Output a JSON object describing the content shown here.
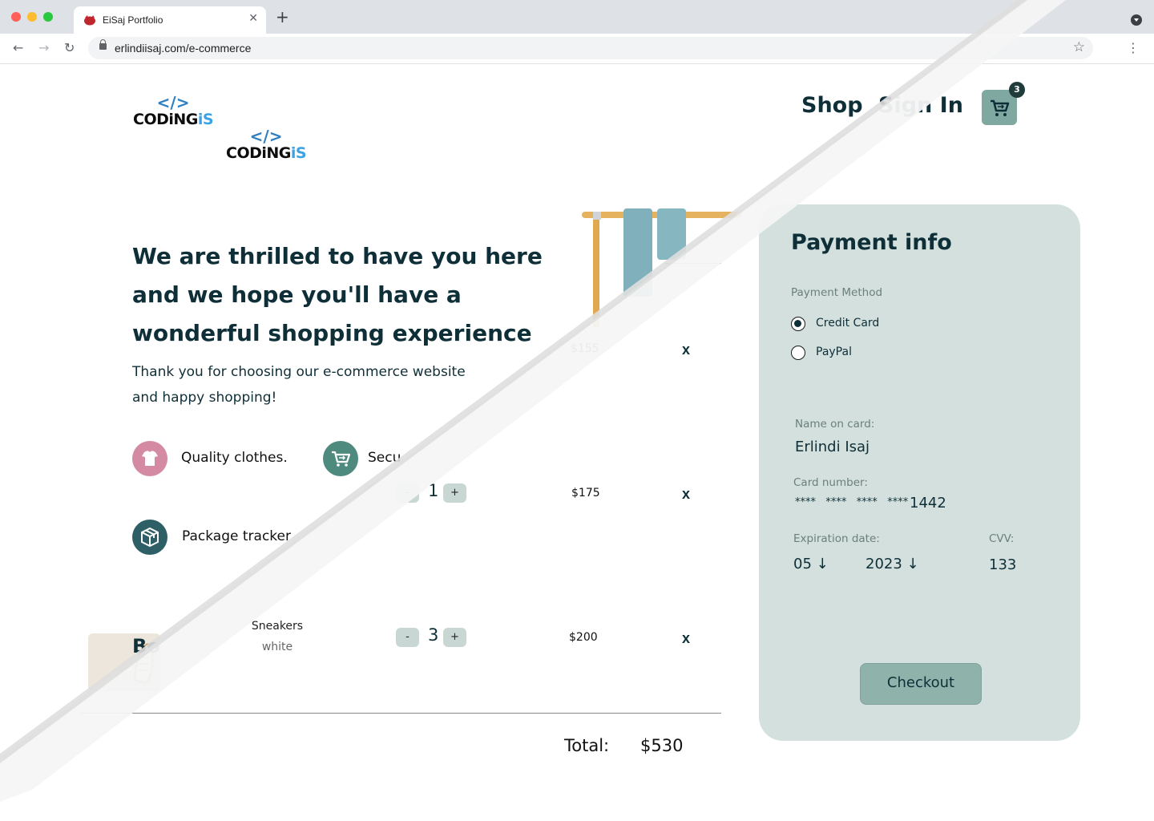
{
  "browser": {
    "tab_title": "EiSaj Portfolio",
    "url": "erlindiisaj.com/e-commerce"
  },
  "logo": {
    "code_symbol": "</>",
    "word_main": "CODiNG",
    "word_accent": "iS"
  },
  "nav": {
    "shop": "Shop",
    "sign_in": "Sign In",
    "cart_count": "3"
  },
  "hero": {
    "title": "We are thrilled to have you here and we hope you'll have a wonderful shopping experience",
    "subtitle": "Thank you for choosing our e-commerce website and happy shopping!"
  },
  "features": [
    {
      "label": "Quality clothes.",
      "icon": "tshirt-icon",
      "color": "#d48aa3"
    },
    {
      "label": "Secu",
      "icon": "cart-icon",
      "color": "#4f8a7e"
    },
    {
      "label": "Package tracker",
      "icon": "package-icon",
      "color": "#2f5f66"
    }
  ],
  "cart": {
    "items": [
      {
        "price": "$155",
        "remove": "x"
      },
      {
        "qty": "1",
        "minus": "-",
        "plus": "+",
        "price": "$175",
        "remove": "x"
      },
      {
        "name": "Sneakers",
        "color": "white",
        "partial_label": "Bo",
        "qty": "3",
        "minus": "-",
        "plus": "+",
        "price": "$200",
        "remove": "x"
      }
    ],
    "total_label": "Total:",
    "total_value": "$530"
  },
  "payment": {
    "title": "Payment info",
    "method_label": "Payment Method",
    "methods": [
      {
        "label": "Credit Card",
        "selected": true
      },
      {
        "label": "PayPal",
        "selected": false
      }
    ],
    "name_label": "Name on card:",
    "name_value": "Erlindi Isaj",
    "card_label": "Card number:",
    "card_masked": "****   ****   ****   ****",
    "card_last4": "1442",
    "expiration_label": "Expiration date:",
    "exp_month": "05 ↓",
    "exp_year": "2023 ↓",
    "cvv_label": "CVV:",
    "cvv_value": "133",
    "checkout_label": "Checkout"
  },
  "colors": {
    "primary_text": "#0f2f38",
    "panel_bg": "#d3e0dd",
    "button_bg": "#8fb2aa",
    "cart_button": "#7fa9a0"
  }
}
